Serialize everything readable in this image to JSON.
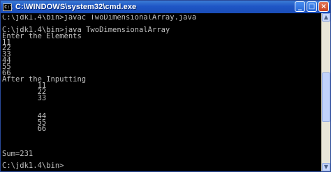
{
  "window": {
    "title": "C:\\WINDOWS\\system32\\cmd.exe",
    "icon_text": "C:\\",
    "controls": {
      "minimize": "_",
      "maximize": "□",
      "close": "×"
    }
  },
  "console": {
    "lines": [
      "C:\\jdk1.4\\bin>javac TwoDimensionalArray.java",
      "",
      "C:\\jdk1.4\\bin>java TwoDimensionalArray",
      "Enter the Elements",
      "11",
      "22",
      "33",
      "44",
      "55",
      "66",
      "After the Inputting",
      "        11",
      "        22",
      "        33",
      "",
      "",
      "        44",
      "        55",
      "        66",
      "",
      "",
      "",
      "Sum=231",
      "",
      "C:\\jdk1.4\\bin>"
    ]
  },
  "scrollbar": {
    "up_glyph": "▲",
    "down_glyph": "▼",
    "thumb_position": 0.55,
    "thumb_fraction": 0.35
  },
  "colors": {
    "titlebar": "#1f56c6",
    "console_bg": "#000000",
    "console_text": "#c0c0c0"
  }
}
